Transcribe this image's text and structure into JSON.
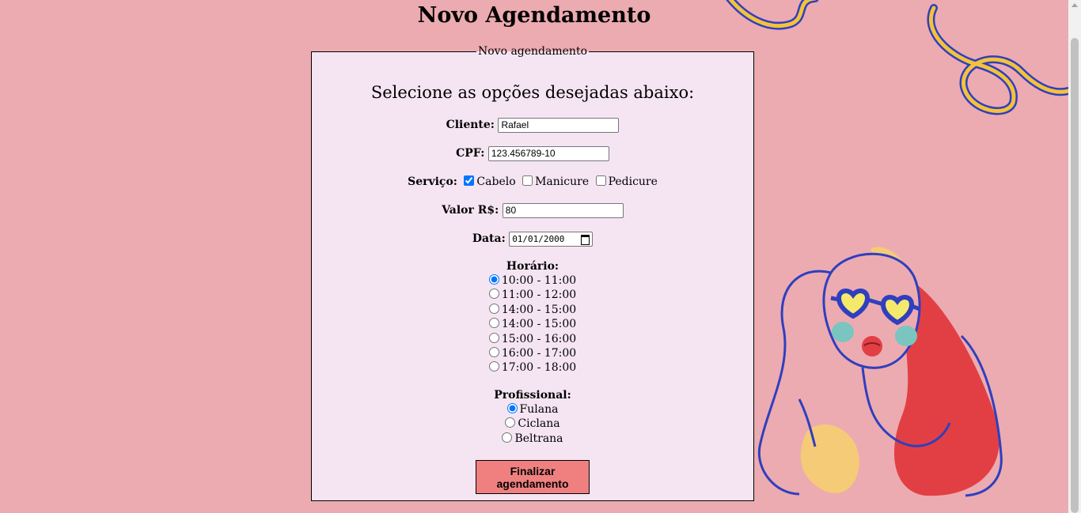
{
  "page": {
    "title": "Novo Agendamento"
  },
  "form": {
    "legend": "Novo agendamento",
    "subtitle": "Selecione as opções desejadas abaixo:",
    "cliente": {
      "label": "Cliente:",
      "value": "Rafael"
    },
    "cpf": {
      "label": "CPF:",
      "value": "123.456789-10"
    },
    "servico": {
      "label": "Serviço:",
      "options": [
        {
          "label": "Cabelo",
          "checked": true
        },
        {
          "label": "Manicure",
          "checked": false
        },
        {
          "label": "Pedicure",
          "checked": false
        }
      ]
    },
    "valor": {
      "label": "Valor R$:",
      "value": "80"
    },
    "data": {
      "label": "Data:",
      "value": "01/01/2000"
    },
    "horario": {
      "label": "Horário:",
      "options": [
        {
          "label": "10:00 - 11:00",
          "checked": true
        },
        {
          "label": "11:00 - 12:00",
          "checked": false
        },
        {
          "label": "14:00 - 15:00",
          "checked": false
        },
        {
          "label": "14:00 - 15:00",
          "checked": false
        },
        {
          "label": "15:00 - 16:00",
          "checked": false
        },
        {
          "label": "16:00 - 17:00",
          "checked": false
        },
        {
          "label": "17:00 - 18:00",
          "checked": false
        }
      ]
    },
    "profissional": {
      "label": "Profissional:",
      "options": [
        {
          "label": "Fulana",
          "checked": true
        },
        {
          "label": "Ciclana",
          "checked": false
        },
        {
          "label": "Beltrana",
          "checked": false
        }
      ]
    },
    "submit_label": "Finalizar agendamento"
  },
  "colors": {
    "background": "#ecabb0",
    "form_background": "#f5e5f2",
    "button": "#f08080",
    "accent_blue": "#2f3fbf",
    "accent_yellow": "#f4c23a",
    "hair_red": "#e23f44"
  },
  "decorations": [
    "swirl-ribbon-illustration",
    "woman-heart-glasses-illustration"
  ]
}
